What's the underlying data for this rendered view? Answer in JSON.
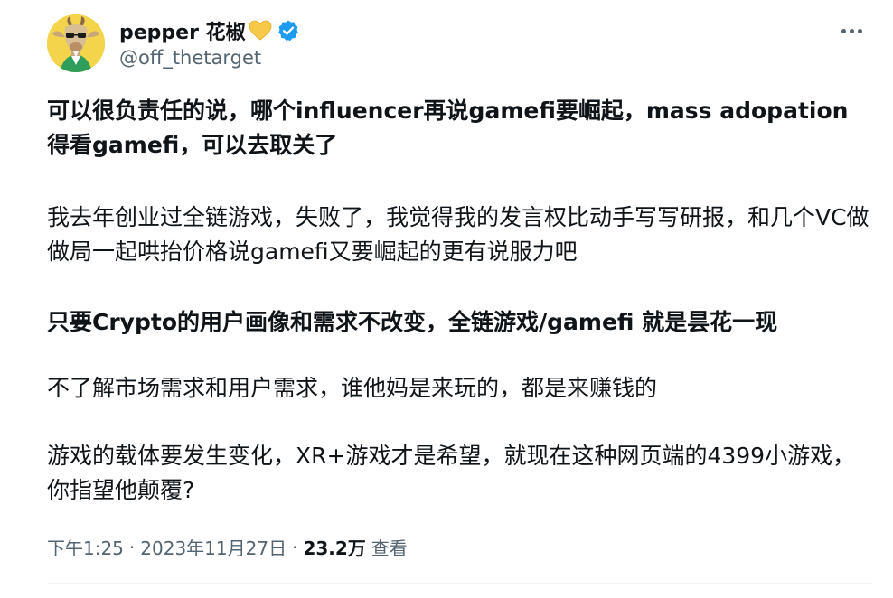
{
  "author": {
    "display_name": "pepper 花椒",
    "handle": "@off_thetarget",
    "heart_color": "#f7c948",
    "verified_color": "#1d9bf0"
  },
  "tweet": {
    "paragraphs": [
      "可以很负责任的说，哪个influencer再说gamefi要崛起，mass adopation得看gamefi，可以去取关了",
      "我去年创业过全链游戏，失败了，我觉得我的发言权比动手写写研报，和几个VC做做局一起哄抬价格说gamefi又要崛起的更有说服力吧",
      "只要Crypto的用户画像和需求不改变，全链游戏/gamefi 就是昙花一现",
      "不了解市场需求和用户需求，谁他妈是来玩的，都是来赚钱的",
      "游戏的载体要发生变化，XR+游戏才是希望，就现在这种网页端的4399小游戏，你指望他颠覆?"
    ]
  },
  "meta": {
    "time": "下午1:25",
    "dot": "·",
    "date": "2023年11月27日",
    "views_count": "23.2万",
    "views_label": "查看"
  },
  "icons": {
    "more": "more-icon",
    "heart": "yellow-heart-icon",
    "verified": "verified-badge-icon",
    "avatar": "goat-avatar"
  }
}
